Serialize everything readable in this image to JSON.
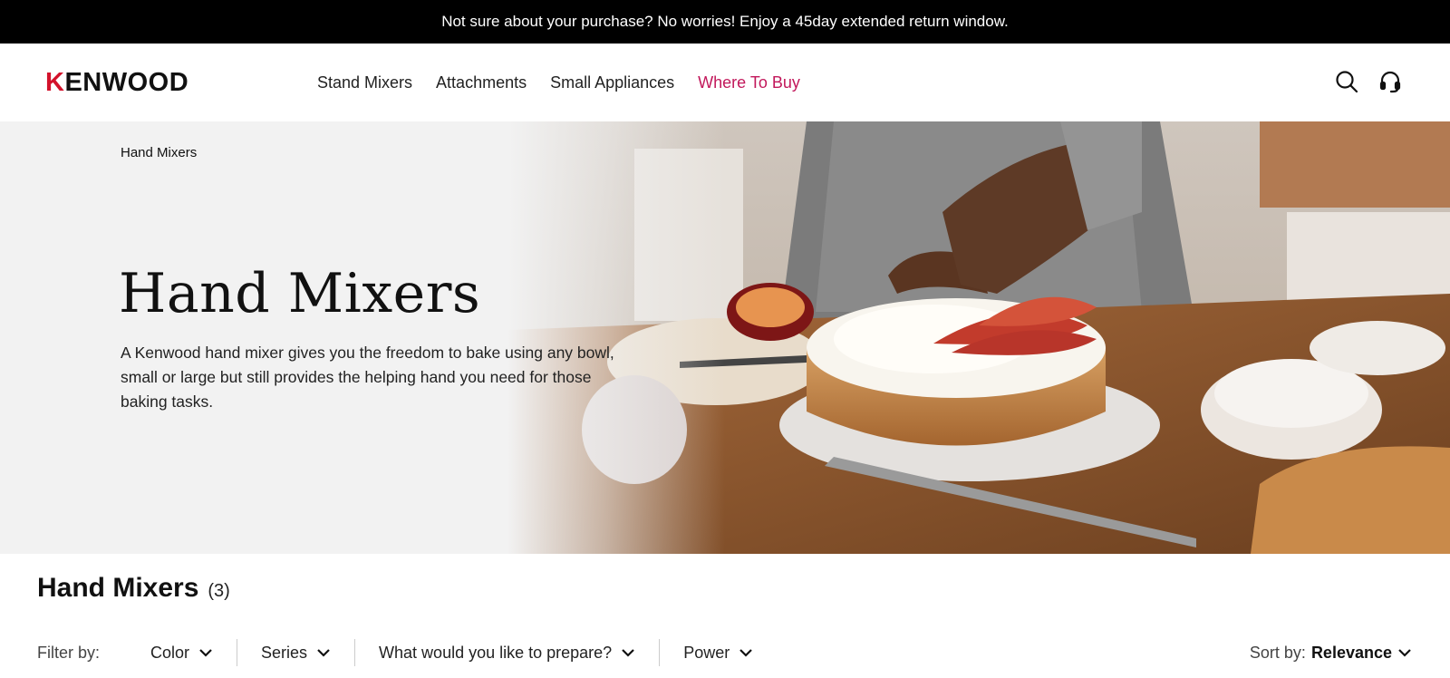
{
  "promo": {
    "text": "Not sure about your purchase? No worries! Enjoy a 45day extended return window."
  },
  "header": {
    "logo_first": "K",
    "logo_rest": "ENWOOD",
    "nav": [
      {
        "label": "Stand Mixers"
      },
      {
        "label": "Attachments"
      },
      {
        "label": "Small Appliances"
      },
      {
        "label": "Where To Buy"
      }
    ],
    "icons": [
      "search-icon",
      "headset-icon"
    ]
  },
  "hero": {
    "breadcrumb": "Hand Mixers",
    "title": "Hand Mixers",
    "description": "A Kenwood hand mixer gives you the freedom to bake using any bowl, small or large but still provides the helping hand you need for those baking tasks."
  },
  "listing": {
    "title": "Hand Mixers",
    "count": "(3)"
  },
  "filters": {
    "label": "Filter by:",
    "items": [
      {
        "label": "Color"
      },
      {
        "label": "Series"
      },
      {
        "label": "What would you like to prepare?"
      },
      {
        "label": "Power"
      }
    ],
    "sort_label": "Sort by:",
    "sort_value": "Relevance"
  },
  "colors": {
    "accent": "#c2185b",
    "brand_red": "#d3122b",
    "promo_bg": "#000000"
  }
}
